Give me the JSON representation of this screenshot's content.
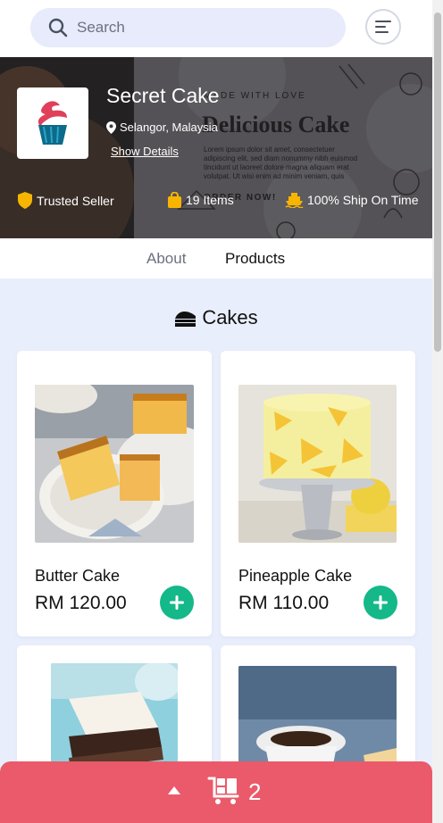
{
  "search": {
    "placeholder": "Search"
  },
  "shop": {
    "name": "Secret Cake",
    "location": "Selangor, Malaysia",
    "show_details": "Show Details",
    "stats": {
      "trusted": "Trusted Seller",
      "items": "19 Items",
      "ship": "100% Ship On Time"
    },
    "banner_art": {
      "made_with_love": "MADE WITH LOVE",
      "headline": "Delicious Cake",
      "body": "Lorem ipsum dolor sit amet, consectetuer adipiscing elit, sed diam nonummy nibh euismod tincidunt ut laoreet dolore magna aliquam erat volutpat. Ut wisi enim ad minim veniam, quis",
      "cta": "ORDER NOW!"
    }
  },
  "tabs": {
    "about": "About",
    "products": "Products"
  },
  "section": {
    "title": "Cakes"
  },
  "products": [
    {
      "name": "Butter Cake",
      "price": "RM 120.00"
    },
    {
      "name": "Pineapple Cake",
      "price": "RM 110.00"
    }
  ],
  "cart": {
    "count": "2"
  },
  "colors": {
    "accent_green": "#14b889",
    "cart_red": "#ea5a6a",
    "badge_yellow": "#f7b500"
  }
}
